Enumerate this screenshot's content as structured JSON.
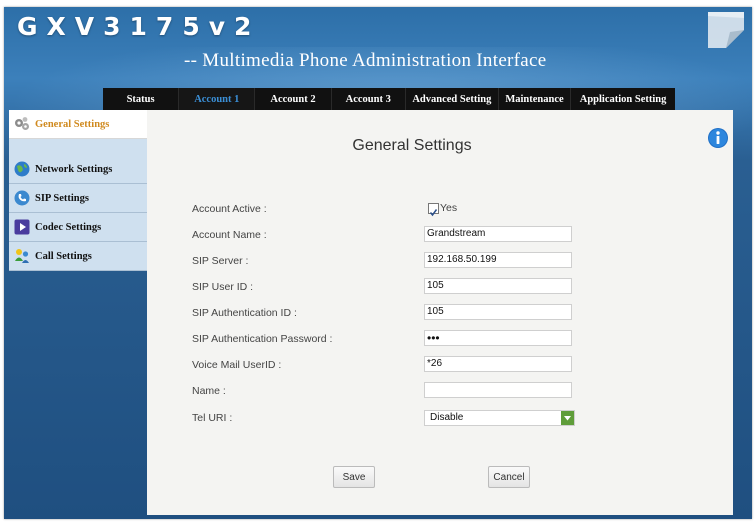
{
  "header": {
    "brand": "GXV3175v2",
    "subtitle": "-- Multimedia Phone Administration Interface"
  },
  "nav": {
    "items": [
      {
        "label": "Status"
      },
      {
        "label": "Account 1"
      },
      {
        "label": "Account 2"
      },
      {
        "label": "Account 3"
      },
      {
        "label": "Advanced Setting"
      },
      {
        "label": "Maintenance"
      },
      {
        "label": "Application Setting"
      }
    ]
  },
  "sidebar": {
    "items": [
      {
        "label": "General Settings",
        "icon": "gears-icon"
      },
      {
        "label": "Network Settings",
        "icon": "globe-icon"
      },
      {
        "label": "SIP Settings",
        "icon": "phone-icon"
      },
      {
        "label": "Codec Settings",
        "icon": "media-icon"
      },
      {
        "label": "Call Settings",
        "icon": "users-icon"
      }
    ]
  },
  "main": {
    "title": "General Settings",
    "form": {
      "account_active_label": "Account Active :",
      "account_active_value": "Yes",
      "account_name_label": "Account Name :",
      "account_name_value": "Grandstream",
      "sip_server_label": "SIP Server :",
      "sip_server_value": "192.168.50.199",
      "sip_user_id_label": "SIP User ID :",
      "sip_user_id_value": "105",
      "sip_auth_id_label": "SIP Authentication ID :",
      "sip_auth_id_value": "105",
      "sip_auth_password_label": "SIP Authentication Password :",
      "sip_auth_password_value": "•••",
      "voicemail_label": "Voice Mail UserID :",
      "voicemail_value": "*26",
      "name_label": "Name :",
      "name_value": "",
      "tel_uri_label": "Tel URI :",
      "tel_uri_value": "Disable"
    },
    "save_label": "Save",
    "cancel_label": "Cancel"
  },
  "colors": {
    "nav_bg": "#111111",
    "nav_active": "#3b8fd6",
    "sidebar_active": "#d08a1f",
    "sidebar_bg": "#cfe0ef",
    "frame_blue": "#2d6fa8"
  }
}
